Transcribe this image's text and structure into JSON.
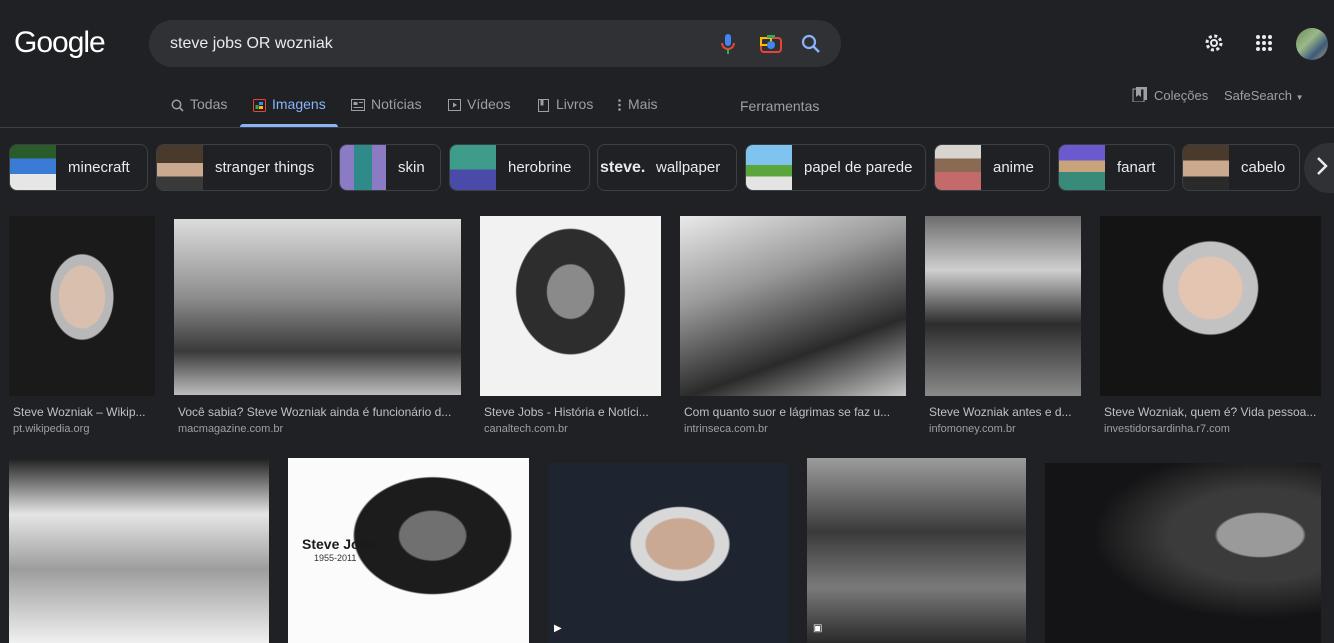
{
  "header": {
    "logo_text": "Google",
    "search_value": "steve jobs OR wozniak",
    "icons": [
      "mic-icon",
      "camera-icon",
      "search-icon",
      "settings-icon",
      "apps-icon",
      "avatar"
    ]
  },
  "tabs": [
    {
      "label": "Todas",
      "icon": "search-icon"
    },
    {
      "label": "Imagens",
      "icon": "image-icon",
      "active": true
    },
    {
      "label": "Notícias",
      "icon": "news-icon"
    },
    {
      "label": "Vídeos",
      "icon": "video-icon"
    },
    {
      "label": "Livros",
      "icon": "book-icon"
    },
    {
      "label": "Mais",
      "icon": "more-icon"
    }
  ],
  "tools_label": "Ferramentas",
  "collections_label": "Coleções",
  "safesearch_label": "SafeSearch",
  "chips": [
    {
      "label": "minecraft"
    },
    {
      "label": "stranger things"
    },
    {
      "label": "skin"
    },
    {
      "label": "herobrine"
    },
    {
      "label": "wallpaper",
      "logo_text": "steve."
    },
    {
      "label": "papel de parede"
    },
    {
      "label": "anime"
    },
    {
      "label": "fanart"
    },
    {
      "label": "cabelo"
    }
  ],
  "results_row1": [
    {
      "title": "Steve Wozniak – Wikip...",
      "source": "pt.wikipedia.org"
    },
    {
      "title": "Você sabia? Steve Wozniak ainda é funcionário d...",
      "source": "macmagazine.com.br"
    },
    {
      "title": "Steve Jobs - História e Notíci...",
      "source": "canaltech.com.br"
    },
    {
      "title": "Com quanto suor e lágrimas se faz u...",
      "source": "intrinseca.com.br"
    },
    {
      "title": "Steve Wozniak antes e d...",
      "source": "infomoney.com.br"
    },
    {
      "title": "Steve Wozniak, quem é? Vida pessoa...",
      "source": "investidorsardinha.r7.com"
    }
  ],
  "row2_image_text": {
    "name": "Steve Jobs",
    "years": "1955-2011"
  },
  "colors": {
    "background": "#202124",
    "accent": "#8ab4f8",
    "text": "#bdc1c6"
  }
}
